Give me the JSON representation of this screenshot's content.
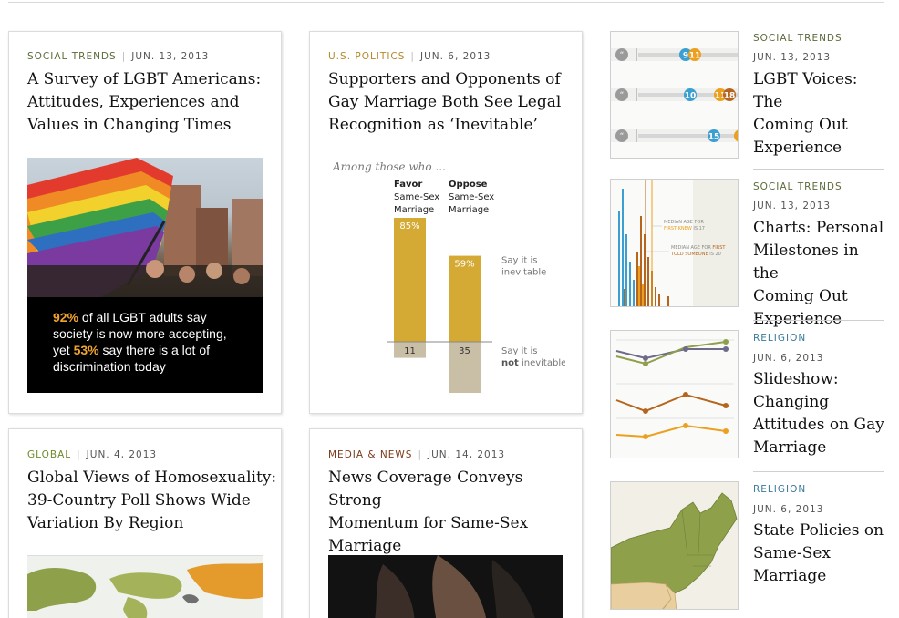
{
  "cards": [
    {
      "category": "Social Trends",
      "date": "Jun. 13, 2013",
      "title_lines": [
        "A Survey of LGBT Americans:",
        "Attitudes, Experiences and",
        "Values in Changing Times"
      ],
      "caption": {
        "p1_hl": "92%",
        "p1": " of all LGBT adults say",
        "p2": "society is now more accepting,",
        "p3_pre": "yet ",
        "p3_hl": "53%",
        "p3": " say there is a lot of",
        "p4": "discrimination today"
      }
    },
    {
      "category": "U.S. Politics",
      "date": "Jun. 6, 2013",
      "title_lines": [
        "Supporters and Opponents of",
        "Gay Marriage Both See Legal",
        "Recognition as ‘Inevitable’"
      ]
    },
    {
      "category": "Global",
      "date": "Jun. 4, 2013",
      "title_lines": [
        "Global Views of Homosexuality:",
        "39-Country Poll Shows Wide",
        "Variation By Region"
      ]
    },
    {
      "category": "Media & News",
      "date": "Jun. 14, 2013",
      "title_lines": [
        "News Coverage Conveys Strong",
        "Momentum for Same-Sex",
        "Marriage"
      ]
    }
  ],
  "chart_data": {
    "type": "bar",
    "title": "Among those who ...",
    "categories": [
      "Favor Same-Sex Marriage",
      "Oppose Same-Sex Marriage"
    ],
    "category_lines": [
      [
        "Favor",
        "Same-Sex",
        "Marriage"
      ],
      [
        "Oppose",
        "Same-Sex",
        "Marriage"
      ]
    ],
    "series": [
      {
        "name": "Say it is inevitable",
        "values": [
          85,
          59
        ]
      },
      {
        "name": "Say it is not inevitable",
        "values": [
          11,
          35
        ]
      }
    ],
    "series_label_lines": [
      [
        "Say it is",
        "inevitable"
      ],
      [
        "Say it is",
        "not inevitable"
      ]
    ],
    "colors": {
      "inevitable": "#d4a934",
      "not_inevitable": "#c9bfa6"
    }
  },
  "side": [
    {
      "category": "Social Trends",
      "date": "Jun. 13, 2013",
      "title_lines": [
        "LGBT Voices: The",
        "Coming Out",
        "Experience"
      ],
      "thumb_numbers": [
        "9",
        "11",
        "10",
        "11",
        "18",
        "15"
      ]
    },
    {
      "category": "Social Trends",
      "date": "Jun. 13, 2013",
      "title_lines": [
        "Charts: Personal",
        "Milestones in the",
        "Coming Out",
        "Experience"
      ],
      "thumb_labels": {
        "first_knew_a": "MEDIAN AGE FOR",
        "first_knew_b": "FIRST KNEW",
        "first_knew_c": " IS 17",
        "first_told_a": "MEDIAN AGE FOR ",
        "first_told_b": "FIRST",
        "first_told_c": "TOLD SOMEONE",
        "first_told_d": " IS 20"
      }
    },
    {
      "category": "Religion",
      "date": "Jun. 6, 2013",
      "title_lines": [
        "Slideshow:",
        "Changing",
        "Attitudes on Gay",
        "Marriage"
      ]
    },
    {
      "category": "Religion",
      "date": "Jun. 6, 2013",
      "title_lines": [
        "State Policies on",
        "Same-Sex",
        "Marriage"
      ]
    }
  ],
  "colors": {
    "social": "#5b6b3a",
    "politics": "#b5882a",
    "global": "#6d8a2a",
    "media": "#7a3b1a",
    "religion": "#3a7a9a"
  }
}
